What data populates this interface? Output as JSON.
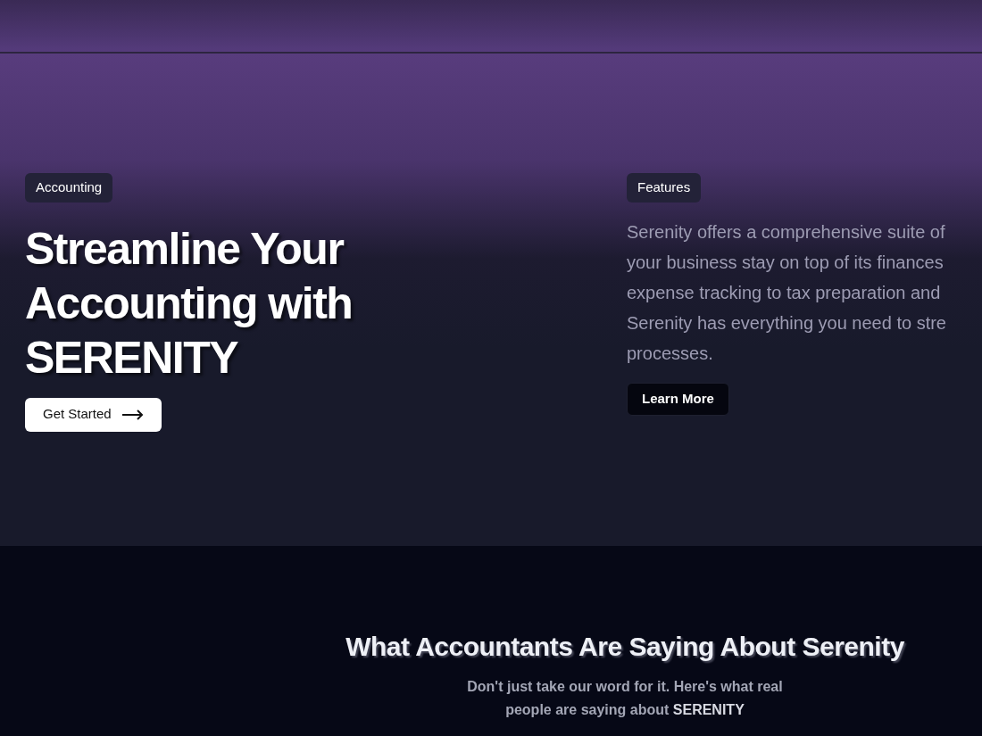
{
  "hero": {
    "badge": "Accounting",
    "title_lines": [
      "Streamline Your",
      "Accounting with",
      "SERENITY"
    ],
    "cta": "Get Started"
  },
  "features": {
    "badge": "Features",
    "description_lines": [
      "Serenity offers a comprehensive suite of",
      "your business stay on top of its finances",
      "expense tracking to tax preparation and",
      "Serenity has everything you need to stre",
      "processes."
    ],
    "button": "Learn More"
  },
  "testimonials": {
    "title": "What Accountants Are Saying About Serenity",
    "subtitle_lines": [
      "Don't just take our word for it. Here's what real",
      "people are saying about **SERENITY**"
    ]
  }
}
